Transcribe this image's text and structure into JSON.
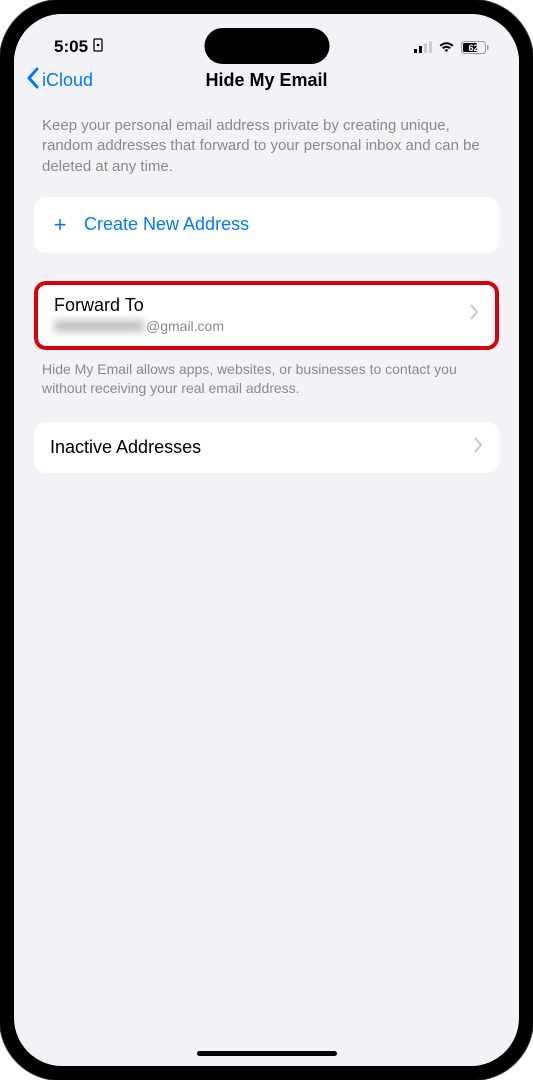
{
  "statusBar": {
    "time": "5:05",
    "batteryLevel": "62"
  },
  "nav": {
    "backLabel": "iCloud",
    "title": "Hide My Email"
  },
  "descriptionText": "Keep your personal email address private by creating unique, random addresses that forward to your personal inbox and can be deleted at any time.",
  "createAddress": {
    "label": "Create New Address"
  },
  "forwardTo": {
    "title": "Forward To",
    "emailSuffix": "@gmail.com",
    "footerText": "Hide My Email allows apps, websites, or businesses to contact you without receiving your real email address."
  },
  "inactiveAddresses": {
    "title": "Inactive Addresses"
  }
}
